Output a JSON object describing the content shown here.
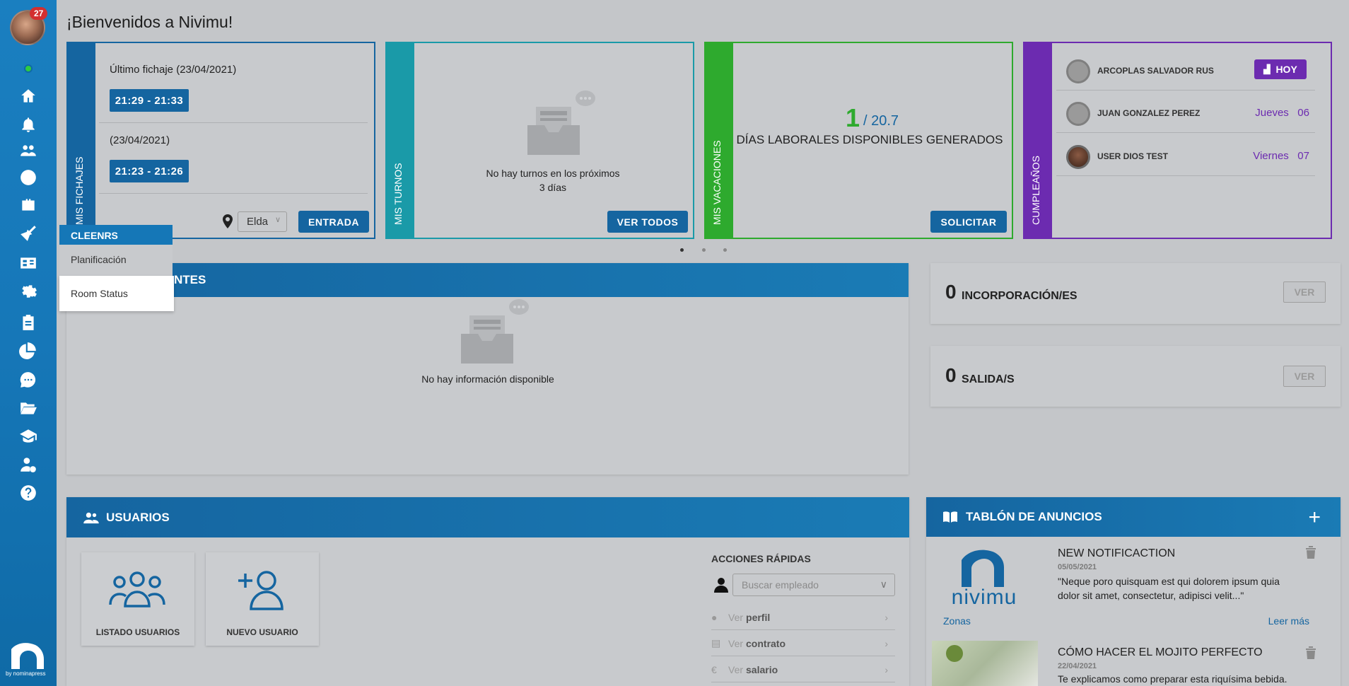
{
  "header": {
    "title": "¡Bienvenidos a Nivimu!"
  },
  "user": {
    "notifications": "27"
  },
  "sidebar": {
    "brand_by": "by nominapress"
  },
  "fichajes": {
    "label": "MIS FICHAJES",
    "last_title": "Último fichaje (23/04/2021)",
    "last_time": "21:29 - 21:33",
    "prev_title": "(23/04/2021)",
    "prev_time": "21:23 - 21:26",
    "location": "Elda",
    "entry_button": "ENTRADA"
  },
  "turnos": {
    "label": "MIS TURNOS",
    "empty_line1": "No hay turnos en los próximos",
    "empty_line2": "3 días",
    "button": "VER TODOS"
  },
  "vacaciones": {
    "label": "MIS VACACIONES",
    "available": "1",
    "total": "/ 20.7",
    "description": "DÍAS LABORALES DISPONIBLES GENERADOS",
    "button": "SOLICITAR"
  },
  "cumpleanos": {
    "label": "CUMPLEAÑOS",
    "entries": [
      {
        "name": "ARCOPLAS SALVADOR RUS",
        "date": "HOY"
      },
      {
        "name": "JUAN GONZALEZ PEREZ",
        "date": "Jueves   06"
      },
      {
        "name": "USER DIOS TEST",
        "date": "Viernes   07"
      }
    ]
  },
  "pending": {
    "title": "NTES",
    "empty": "No hay información disponible"
  },
  "incorporaciones": {
    "count": "0",
    "label": "INCORPORACIÓN/ES",
    "button": "VER"
  },
  "salidas": {
    "count": "0",
    "label": "SALIDA/S",
    "button": "VER"
  },
  "usuarios": {
    "title": "USUARIOS",
    "list_label": "LISTADO USUARIOS",
    "new_label": "NUEVO USUARIO",
    "quick_title": "ACCIONES RÁPIDAS",
    "search_placeholder": "Buscar empleado",
    "actions": [
      {
        "verb": "Ver",
        "object": "perfil"
      },
      {
        "verb": "Ver",
        "object": "contrato"
      },
      {
        "verb": "Ver",
        "object": "salario"
      }
    ]
  },
  "tablon": {
    "title": "TABLÓN DE ANUNCIOS",
    "items": [
      {
        "title": "NEW NOTIFICACTION",
        "date": "05/05/2021",
        "text": "\"Neque poro quisquam est qui dolorem ipsum quia dolor sit amet, consectetur, adipisci velit...\"",
        "tag": "Zonas",
        "more": "Leer más",
        "logo_text": "nivimu"
      },
      {
        "title": "CÓMO HACER EL MOJITO PERFECTO",
        "date": "22/04/2021",
        "text": "Te explicamos como preparar esta riquísima bebida."
      }
    ]
  },
  "menu": {
    "header": "CLEENRS",
    "items": [
      "Planificación",
      "Room Status"
    ]
  },
  "colors": {
    "accent": "#1565a0",
    "teal": "#1a9aa8",
    "green": "#2eaa2e",
    "purple": "#6c2bb0"
  }
}
